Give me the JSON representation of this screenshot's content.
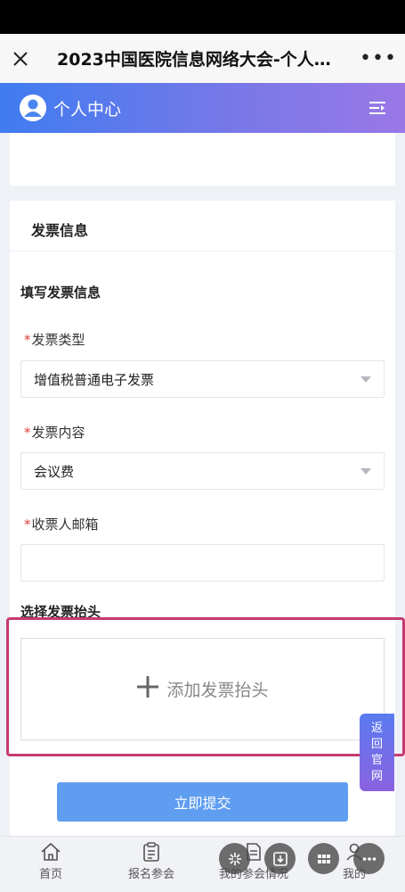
{
  "wechat_bar": {
    "close_icon": "close-icon",
    "title": "2023中国医院信息网络大会-个人…",
    "more_label": "•••"
  },
  "app_header": {
    "title": "个人中心",
    "menu_icon": "menu-icon",
    "gradient": [
      "#3f7cf0",
      "#9a78e6"
    ]
  },
  "invoice": {
    "section_title": "发票信息",
    "fill_heading": "填写发票信息",
    "required_mark": "*",
    "type_label": "发票类型",
    "type_value": "增值税普通电子发票",
    "content_label": "发票内容",
    "content_value": "会议费",
    "email_label": "收票人邮箱",
    "email_value": "",
    "header_heading": "选择发票抬头",
    "add_header_label": "添加发票抬头"
  },
  "back_tab": {
    "chars": [
      "返",
      "回",
      "官",
      "网"
    ]
  },
  "submit_label": "立即提交",
  "tabbar": {
    "items": [
      {
        "label": "首页",
        "icon": "home-icon"
      },
      {
        "label": "报名参会",
        "icon": "clipboard-icon"
      },
      {
        "label": "我的参会情况",
        "icon": "document-icon"
      },
      {
        "label": "我的",
        "icon": "user-icon"
      }
    ]
  },
  "floating_controls": [
    "sparkle-icon",
    "download-icon",
    "grid-icon",
    "more-icon"
  ],
  "colors": {
    "accent": "#5f9df0",
    "required": "#e0403a",
    "highlight": "#c63a70"
  }
}
